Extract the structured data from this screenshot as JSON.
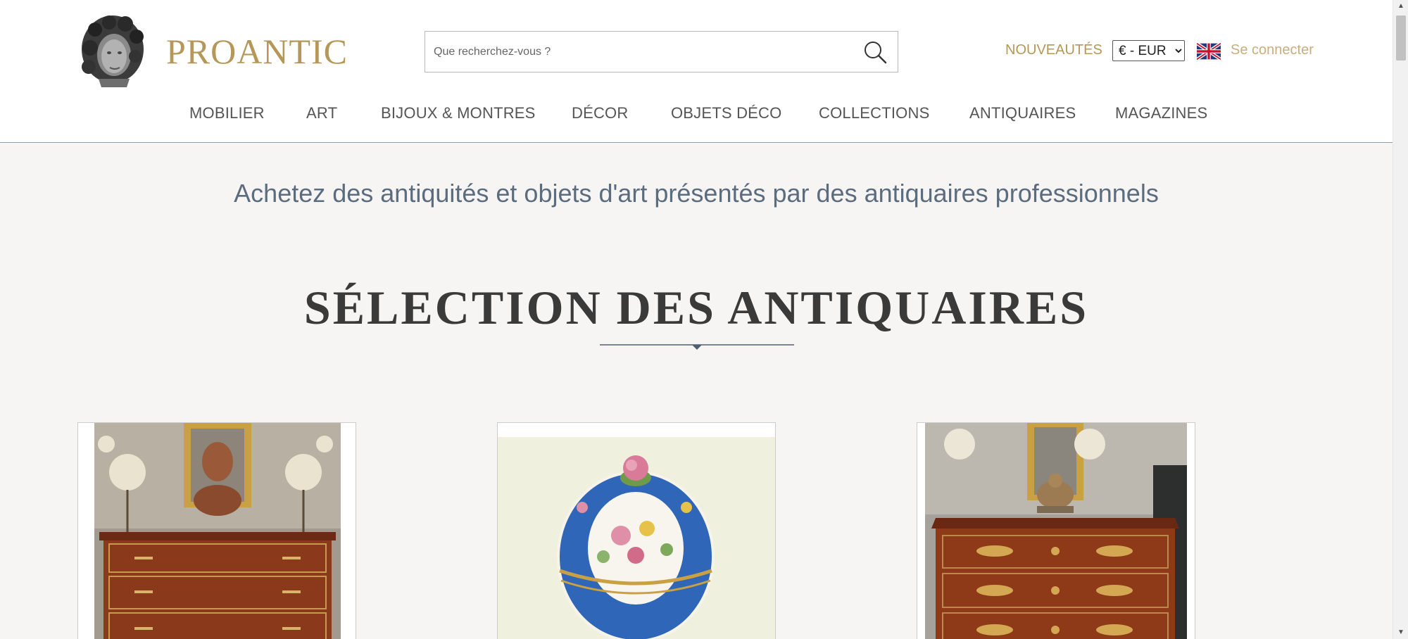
{
  "brand": {
    "name": "PROANTIC",
    "logo_icon": "bust-logo-icon"
  },
  "search": {
    "placeholder": "Que recherchez-vous ?",
    "icon": "search-icon"
  },
  "header_links": {
    "nouveautes": "NOUVEAUTÉS",
    "currency": "€ - EUR",
    "language_icon": "uk-flag-icon",
    "login": "Se connecter"
  },
  "nav": {
    "items": [
      "MOBILIER",
      "ART",
      "BIJOUX & MONTRES",
      "DÉCOR",
      "OBJETS DÉCO",
      "COLLECTIONS",
      "ANTIQUAIRES",
      "MAGAZINES"
    ]
  },
  "main": {
    "tagline": "Achetez des antiquités et objets d'art présentés par des antiquaires professionnels",
    "section_title": "SÉLECTION DES ANTIQUAIRES"
  },
  "colors": {
    "gold": "#b59759",
    "login_gold": "#c9ae7d",
    "tagline_blue": "#5c6c7f",
    "background": "#f6f5f3"
  }
}
